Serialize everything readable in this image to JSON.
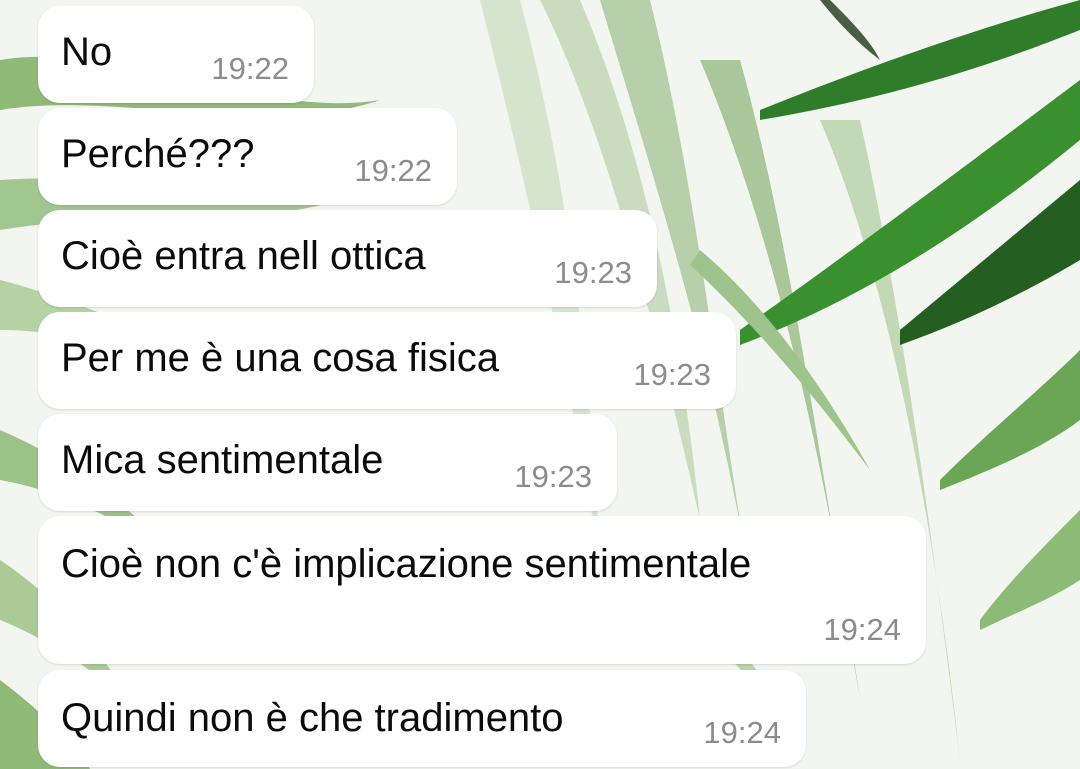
{
  "conversation": {
    "messages": [
      {
        "text": "No",
        "time": "19:22"
      },
      {
        "text": "Perché???",
        "time": "19:22"
      },
      {
        "text": "Cioè entra nell ottica",
        "time": "19:23"
      },
      {
        "text": "Per me è una cosa fisica",
        "time": "19:23"
      },
      {
        "text": "Mica sentimentale",
        "time": "19:23"
      },
      {
        "text": "Cioè non c'è implicazione sentimentale",
        "time": "19:24"
      },
      {
        "text": "Quindi non è che tradimento",
        "time": "19:24"
      }
    ]
  },
  "theme": {
    "bubble_color": "#ffffff",
    "text_color": "#0b0b0b",
    "time_color": "#8c8c8c",
    "wallpaper": "green-leaves-watercolor"
  }
}
